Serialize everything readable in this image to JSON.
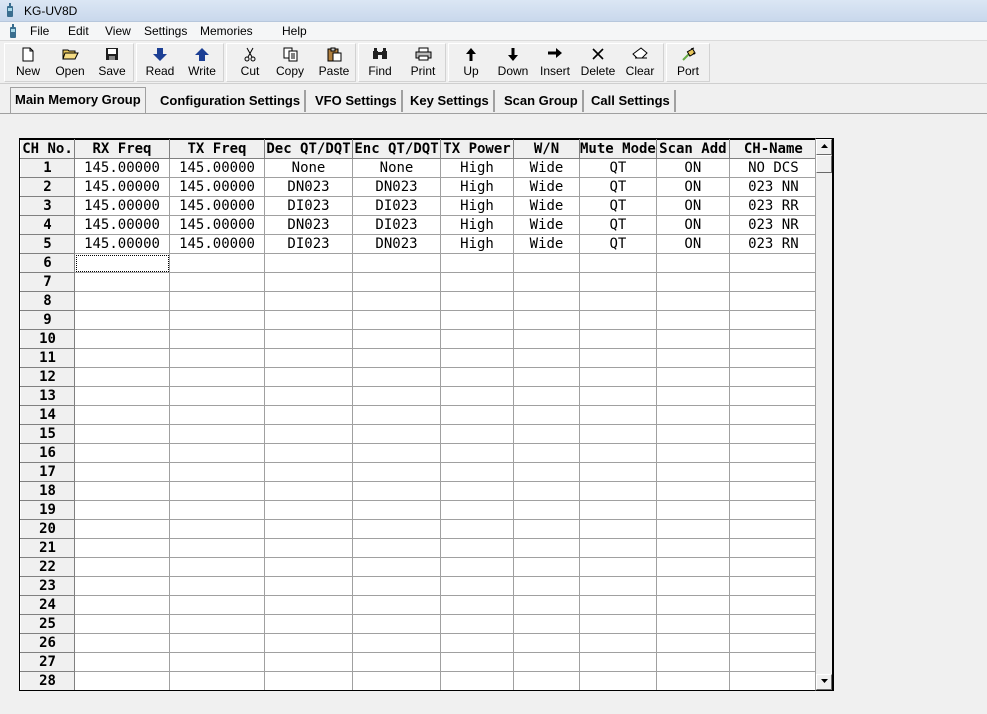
{
  "window": {
    "title": "KG-UV8D"
  },
  "menu": [
    "File",
    "Edit",
    "View",
    "Settings",
    "Memories",
    "Help"
  ],
  "toolbar": {
    "buttons": [
      {
        "label": "New",
        "icon": "new-file-icon"
      },
      {
        "label": "Open",
        "icon": "open-folder-icon"
      },
      {
        "label": "Save",
        "icon": "floppy-disk-icon"
      },
      {
        "label": "Read",
        "icon": "arrow-down-icon"
      },
      {
        "label": "Write",
        "icon": "arrow-up-icon"
      },
      {
        "label": "Cut",
        "icon": "scissors-icon"
      },
      {
        "label": "Copy",
        "icon": "copy-icon"
      },
      {
        "label": "Paste",
        "icon": "paste-icon"
      },
      {
        "label": "Find",
        "icon": "binoculars-icon"
      },
      {
        "label": "Print",
        "icon": "printer-icon"
      },
      {
        "label": "Up",
        "icon": "up-arrow-icon"
      },
      {
        "label": "Down",
        "icon": "down-arrow-icon"
      },
      {
        "label": "Insert",
        "icon": "right-arrow-icon"
      },
      {
        "label": "Delete",
        "icon": "x-icon"
      },
      {
        "label": "Clear",
        "icon": "eraser-icon"
      },
      {
        "label": "Port",
        "icon": "port-icon"
      }
    ]
  },
  "tabs": [
    "Main Memory Group",
    "Configuration Settings",
    "VFO Settings",
    "Key Settings",
    "Scan Group",
    "Call Settings"
  ],
  "active_tab": "Main Memory Group",
  "grid": {
    "headers": [
      "CH No.",
      "RX Freq",
      "TX Freq",
      "Dec QT/DQT",
      "Enc QT/DQT",
      "TX Power",
      "W/N",
      "Mute Mode",
      "Scan Add",
      "CH-Name"
    ],
    "rows": [
      [
        "1",
        "145.00000",
        "145.00000",
        "None",
        "None",
        "High",
        "Wide",
        "QT",
        "ON",
        "NO DCS"
      ],
      [
        "2",
        "145.00000",
        "145.00000",
        "DN023",
        "DN023",
        "High",
        "Wide",
        "QT",
        "ON",
        "023 NN"
      ],
      [
        "3",
        "145.00000",
        "145.00000",
        "DI023",
        "DI023",
        "High",
        "Wide",
        "QT",
        "ON",
        "023 RR"
      ],
      [
        "4",
        "145.00000",
        "145.00000",
        "DN023",
        "DI023",
        "High",
        "Wide",
        "QT",
        "ON",
        "023 NR"
      ],
      [
        "5",
        "145.00000",
        "145.00000",
        "DI023",
        "DN023",
        "High",
        "Wide",
        "QT",
        "ON",
        "023 RN"
      ],
      [
        "6",
        "",
        "",
        "",
        "",
        "",
        "",
        "",
        "",
        ""
      ],
      [
        "7",
        "",
        "",
        "",
        "",
        "",
        "",
        "",
        "",
        ""
      ],
      [
        "8",
        "",
        "",
        "",
        "",
        "",
        "",
        "",
        "",
        ""
      ],
      [
        "9",
        "",
        "",
        "",
        "",
        "",
        "",
        "",
        "",
        ""
      ],
      [
        "10",
        "",
        "",
        "",
        "",
        "",
        "",
        "",
        "",
        ""
      ],
      [
        "11",
        "",
        "",
        "",
        "",
        "",
        "",
        "",
        "",
        ""
      ],
      [
        "12",
        "",
        "",
        "",
        "",
        "",
        "",
        "",
        "",
        ""
      ],
      [
        "13",
        "",
        "",
        "",
        "",
        "",
        "",
        "",
        "",
        ""
      ],
      [
        "14",
        "",
        "",
        "",
        "",
        "",
        "",
        "",
        "",
        ""
      ],
      [
        "15",
        "",
        "",
        "",
        "",
        "",
        "",
        "",
        "",
        ""
      ],
      [
        "16",
        "",
        "",
        "",
        "",
        "",
        "",
        "",
        "",
        ""
      ],
      [
        "17",
        "",
        "",
        "",
        "",
        "",
        "",
        "",
        "",
        ""
      ],
      [
        "18",
        "",
        "",
        "",
        "",
        "",
        "",
        "",
        "",
        ""
      ],
      [
        "19",
        "",
        "",
        "",
        "",
        "",
        "",
        "",
        "",
        ""
      ],
      [
        "20",
        "",
        "",
        "",
        "",
        "",
        "",
        "",
        "",
        ""
      ],
      [
        "21",
        "",
        "",
        "",
        "",
        "",
        "",
        "",
        "",
        ""
      ],
      [
        "22",
        "",
        "",
        "",
        "",
        "",
        "",
        "",
        "",
        ""
      ],
      [
        "23",
        "",
        "",
        "",
        "",
        "",
        "",
        "",
        "",
        ""
      ],
      [
        "24",
        "",
        "",
        "",
        "",
        "",
        "",
        "",
        "",
        ""
      ],
      [
        "25",
        "",
        "",
        "",
        "",
        "",
        "",
        "",
        "",
        ""
      ],
      [
        "26",
        "",
        "",
        "",
        "",
        "",
        "",
        "",
        "",
        ""
      ],
      [
        "27",
        "",
        "",
        "",
        "",
        "",
        "",
        "",
        "",
        ""
      ],
      [
        "28",
        "",
        "",
        "",
        "",
        "",
        "",
        "",
        "",
        ""
      ]
    ]
  },
  "colors": {
    "titlebar": "#c9d8ec",
    "face": "#f0f0f0",
    "arrow_blue": "#1c3f94"
  }
}
